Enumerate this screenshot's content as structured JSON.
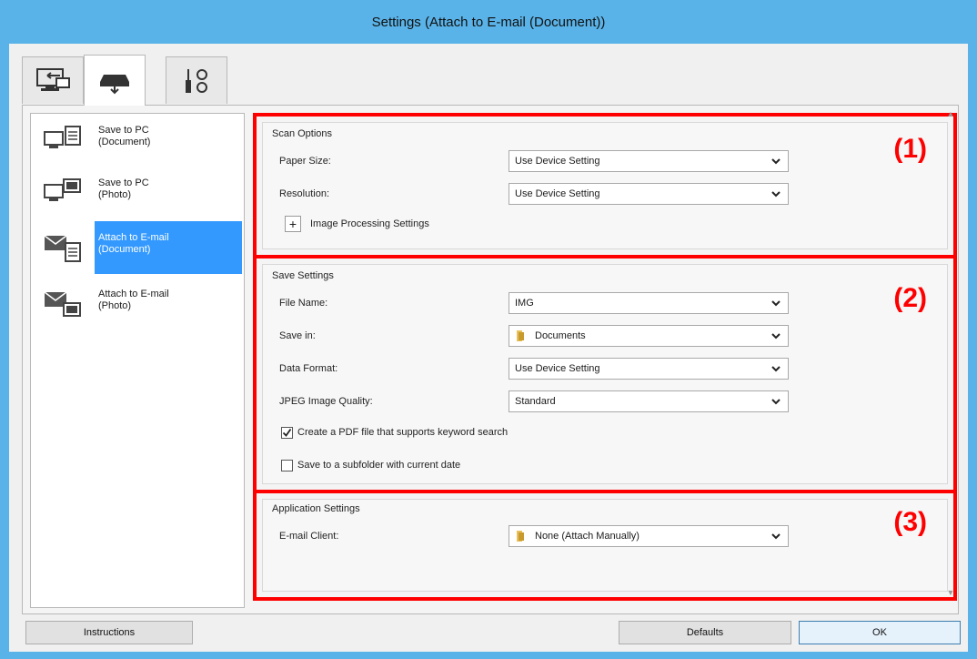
{
  "window": {
    "title": "Settings (Attach to E-mail (Document))"
  },
  "tabs": [
    {
      "name": "scan-from-computer-tab",
      "icon": "computer-scan-icon"
    },
    {
      "name": "scan-from-operation-panel-tab",
      "icon": "scanner-icon"
    },
    {
      "name": "general-settings-tab",
      "icon": "tools-icon"
    }
  ],
  "jobs": [
    {
      "label": "Save to PC\n(Document)",
      "icon": "save-to-pc-document-icon"
    },
    {
      "label": "Save to PC\n(Photo)",
      "icon": "save-to-pc-photo-icon"
    },
    {
      "label": "Attach to E-mail\n(Document)",
      "icon": "attach-email-document-icon",
      "selected": true
    },
    {
      "label": "Attach to E-mail\n(Photo)",
      "icon": "attach-email-photo-icon"
    }
  ],
  "scan_options": {
    "title": "Scan Options",
    "number": "(1)",
    "paper_size_label": "Paper Size:",
    "paper_size_value": "Use Device Setting",
    "resolution_label": "Resolution:",
    "resolution_value": "Use Device Setting",
    "image_processing_label": "Image Processing Settings",
    "expand_symbol": "+"
  },
  "save_settings": {
    "title": "Save Settings",
    "number": "(2)",
    "file_name_label": "File Name:",
    "file_name_value": "IMG",
    "save_in_label": "Save in:",
    "save_in_value": "Documents",
    "data_format_label": "Data Format:",
    "data_format_value": "Use Device Setting",
    "jpeg_quality_label": "JPEG Image Quality:",
    "jpeg_quality_value": "Standard",
    "pdf_keyword_label": "Create a PDF file that supports keyword search",
    "pdf_keyword_checked": true,
    "subfolder_label": "Save to a subfolder with current date",
    "subfolder_checked": false
  },
  "app_settings": {
    "title": "Application Settings",
    "number": "(3)",
    "email_client_label": "E-mail Client:",
    "email_client_value": "None (Attach Manually)"
  },
  "buttons": {
    "instructions": "Instructions",
    "defaults": "Defaults",
    "ok": "OK"
  },
  "colors": {
    "title_bar": "#5ab3e8",
    "highlight": "#ff0000",
    "selection": "#3399ff"
  }
}
